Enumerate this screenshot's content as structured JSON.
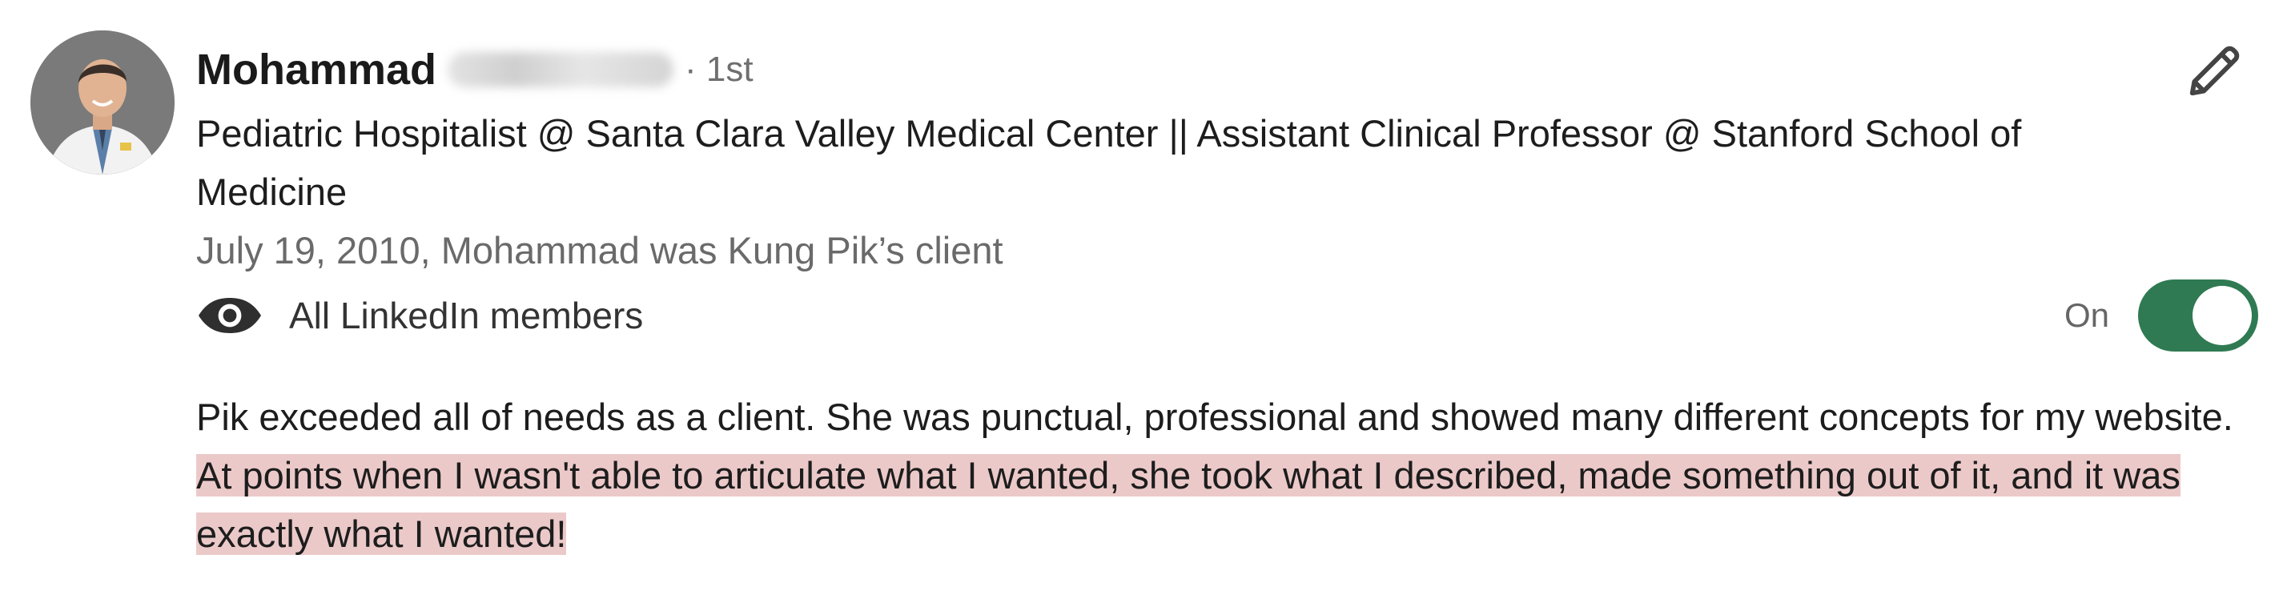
{
  "recommendation": {
    "author": {
      "first_name": "Mohammad",
      "connection_degree": "· 1st",
      "headline": "Pediatric Hospitalist @ Santa Clara Valley Medical Center || Assistant Clinical Professor @ Stanford School of Medicine",
      "avatar_icon": "person-photo"
    },
    "meta": "July 19, 2010, Mohammad was Kung Pik’s client",
    "visibility": {
      "icon": "eye-icon",
      "label": "All LinkedIn members",
      "toggle_state_label": "On",
      "toggle_on": true,
      "toggle_color": "#2f7a52"
    },
    "edit_icon": "pencil-icon",
    "text_plain": "Pik exceeded all of needs as a client. She was punctual, professional and showed many different concepts for my website. ",
    "text_highlighted": "At points when I wasn't able to articulate what I wanted, she took what I described, made something out of it, and it was exactly what I wanted!",
    "highlight_color": "#ecc9c9"
  }
}
